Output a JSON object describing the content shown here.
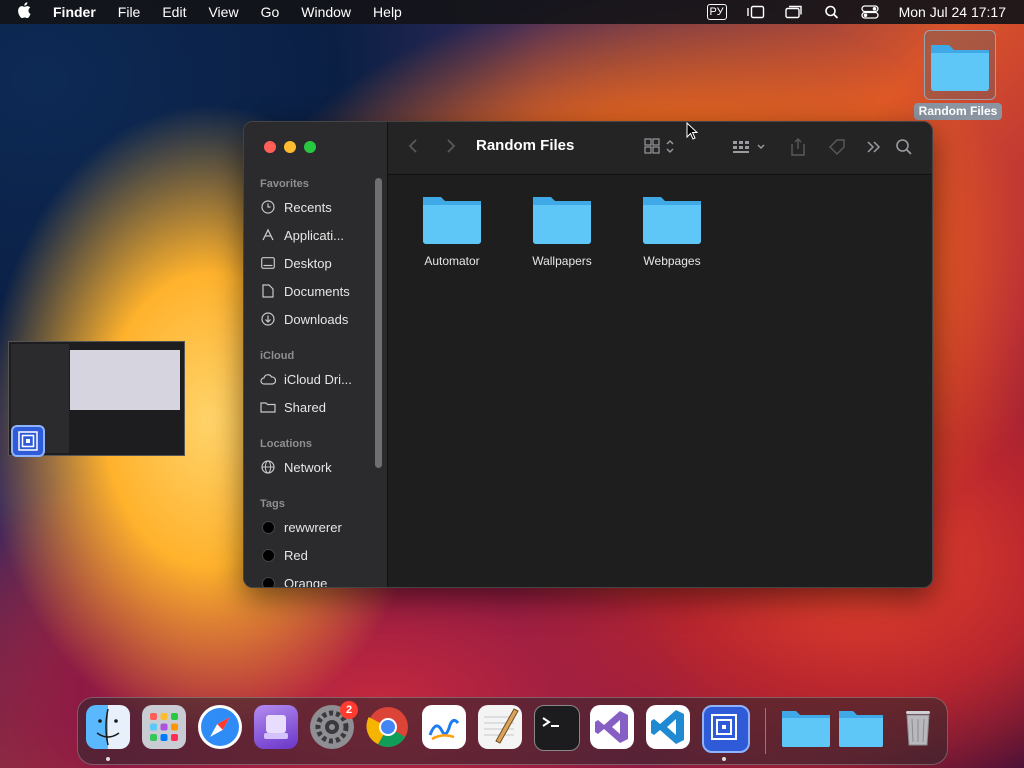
{
  "menubar": {
    "app_name": "Finder",
    "items": [
      "File",
      "Edit",
      "View",
      "Go",
      "Window",
      "Help"
    ],
    "keyboard_layout": "РУ",
    "datetime": "Mon Jul 24  17:17"
  },
  "desktop": {
    "folder_label": "Random Files"
  },
  "finder": {
    "title": "Random Files",
    "sidebar": {
      "favorites_header": "Favorites",
      "favorites": [
        "Recents",
        "Applicati...",
        "Desktop",
        "Documents",
        "Downloads"
      ],
      "icloud_header": "iCloud",
      "icloud": [
        "iCloud Dri...",
        "Shared"
      ],
      "locations_header": "Locations",
      "locations": [
        "Network"
      ],
      "tags_header": "Tags",
      "tags": [
        "rewwrerer",
        "Red",
        "Orange"
      ]
    },
    "files": [
      "Automator",
      "Wallpapers",
      "Webpages"
    ]
  },
  "dock": {
    "apps": [
      "finder-icon",
      "launchpad-icon",
      "safari-icon",
      "app-icon",
      "system-settings-icon",
      "chrome-icon",
      "freeform-icon",
      "textedit-icon",
      "terminal-icon",
      "visual-studio-icon",
      "vscode-icon",
      "stage-app-icon",
      "folder-icon",
      "folder-icon",
      "trash-icon"
    ],
    "settings_badge": "2"
  },
  "colors": {
    "folder_blue": "#5ec7f8",
    "close": "#ff5f57",
    "minimize": "#febc2e",
    "zoom": "#28c840"
  }
}
